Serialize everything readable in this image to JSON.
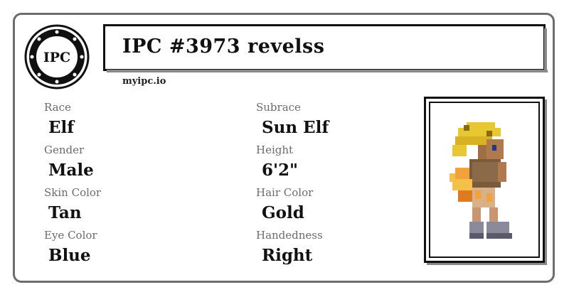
{
  "header": {
    "logo_text": "IPC",
    "title": "IPC #3973 revelss",
    "site": "myipc.io"
  },
  "attributes": {
    "left": [
      {
        "label": "Race",
        "value": "Elf"
      },
      {
        "label": "Gender",
        "value": "Male"
      },
      {
        "label": "Skin Color",
        "value": "Tan"
      },
      {
        "label": "Eye Color",
        "value": "Blue"
      }
    ],
    "right": [
      {
        "label": "Subrace",
        "value": "Sun Elf"
      },
      {
        "label": "Height",
        "value": "6'2\""
      },
      {
        "label": "Hair Color",
        "value": "Gold"
      },
      {
        "label": "Handedness",
        "value": "Right"
      }
    ]
  },
  "colors": {
    "hair": "#e8c832",
    "skin": "#b07a4e",
    "tunic": "#7a5a3a",
    "flame": "#f2a23a"
  },
  "icons": {
    "logo": "ipc-seal-icon",
    "portrait": "character-sprite-icon"
  }
}
